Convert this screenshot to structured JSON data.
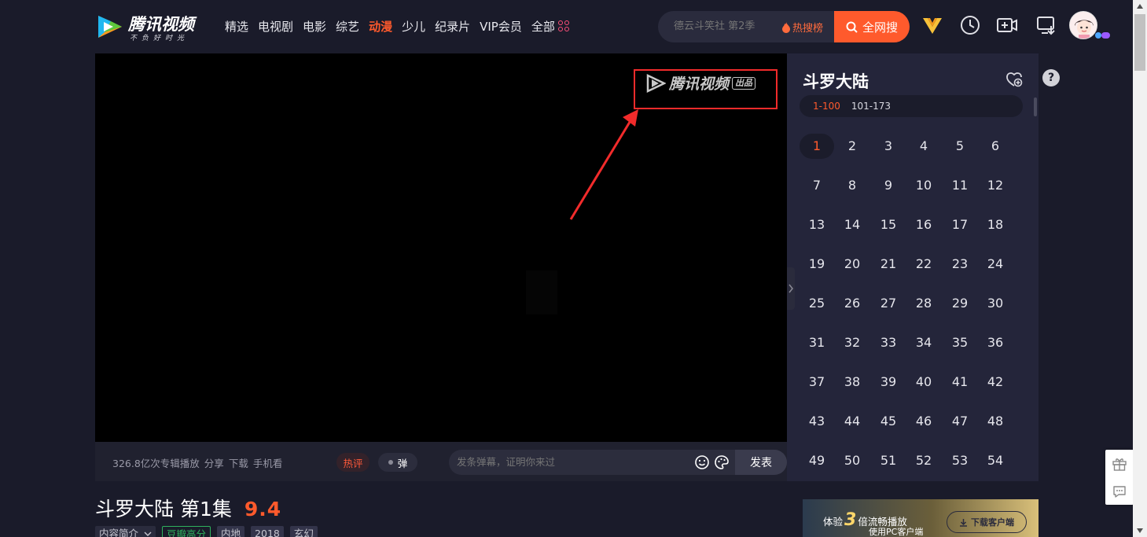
{
  "header": {
    "logo_text": "腾讯视频",
    "logo_slogan": "不负好时光",
    "nav": [
      "精选",
      "电视剧",
      "电影",
      "综艺",
      "动漫",
      "少儿",
      "纪录片",
      "VIP会员"
    ],
    "nav_active_index": 4,
    "nav_all_label": "全部",
    "search_placeholder": "德云斗笑社 第2季",
    "hot_rank_label": "热搜榜",
    "search_button_label": "全网搜",
    "icons": [
      "vip-icon",
      "history-icon",
      "upload-icon",
      "download-client-icon",
      "avatar"
    ]
  },
  "player": {
    "watermark_text": "腾讯视频",
    "watermark_badge": "出品"
  },
  "player_bar": {
    "play_count": "326.8亿次专辑播放",
    "share_label": "分享",
    "download_label": "下载",
    "mobile_label": "手机看",
    "hot_comment_label": "热评",
    "danmu_label": "弹",
    "danmu_placeholder": "发条弹幕，证明你来过",
    "send_label": "发表"
  },
  "episode_panel": {
    "title": "斗罗大陆",
    "ranges": [
      "1-100",
      "101-173"
    ],
    "active_range_index": 0,
    "episodes": [
      "1",
      "2",
      "3",
      "4",
      "5",
      "6",
      "7",
      "8",
      "9",
      "10",
      "11",
      "12",
      "13",
      "14",
      "15",
      "16",
      "17",
      "18",
      "19",
      "20",
      "21",
      "22",
      "23",
      "24",
      "25",
      "26",
      "27",
      "28",
      "29",
      "30",
      "31",
      "32",
      "33",
      "34",
      "35",
      "36",
      "37",
      "38",
      "39",
      "40",
      "41",
      "42",
      "43",
      "44",
      "45",
      "46",
      "47",
      "48",
      "49",
      "50",
      "51",
      "52",
      "53",
      "54"
    ],
    "active_episode_index": 0,
    "help_label": "?"
  },
  "video_info": {
    "title": "斗罗大陆 第1集",
    "score": "9.4",
    "tags": {
      "intro": "内容简介",
      "douban": "豆瓣高分",
      "region": "内地",
      "year": "2018",
      "genre": "玄幻"
    }
  },
  "ad": {
    "line1_prefix": "体验",
    "line1_number": "3",
    "line1_suffix": "倍流畅播放",
    "line2": "使用PC客户端",
    "button_label": "下载客户端"
  },
  "colors": {
    "background": "#1a1b2a",
    "accent": "#ff5a2c",
    "panel": "#24253a",
    "annotation_red": "#f22b2b"
  }
}
